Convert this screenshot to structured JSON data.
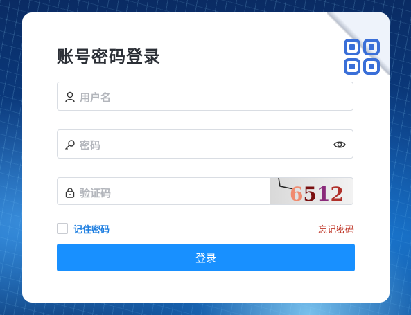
{
  "login": {
    "title": "账号密码登录",
    "username_placeholder": "用户名",
    "password_placeholder": "密码",
    "captcha_placeholder": "验证码",
    "captcha_text": "6512",
    "remember_label": "记住密码",
    "forgot_label": "忘记密码",
    "submit_label": "登录"
  },
  "colors": {
    "accent": "#1890ff",
    "forgot": "#c0392b",
    "remember": "#1d7ee0"
  },
  "icons": [
    "user-icon",
    "key-icon",
    "lock-icon",
    "eye-icon",
    "qrcode-icon"
  ]
}
